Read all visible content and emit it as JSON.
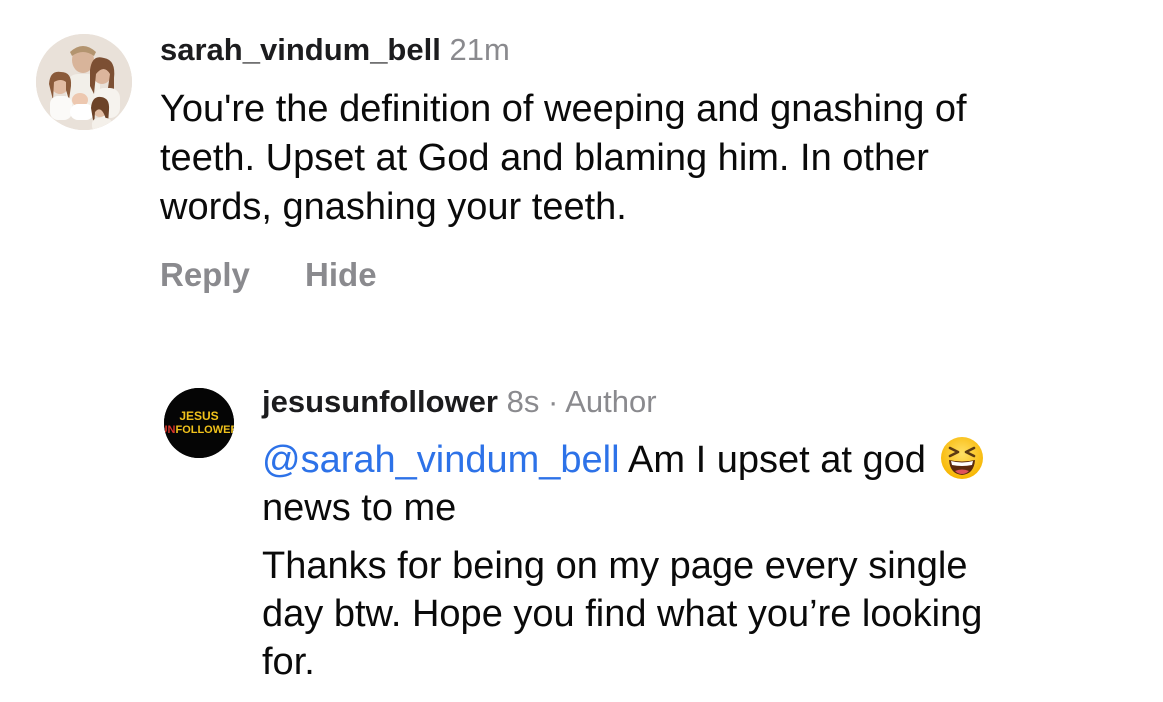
{
  "comment": {
    "username": "sarah_vindum_bell",
    "time": "21m",
    "text_lines": [
      "You're the definition of weeping and gnashing of",
      "teeth. Upset at God and blaming him. In other",
      "words, gnashing your teeth."
    ],
    "actions": {
      "reply": "Reply",
      "hide": "Hide"
    }
  },
  "reply": {
    "username": "jesusunfollower",
    "time": "8s",
    "separator": "·",
    "badge": "Author",
    "avatar_logo": {
      "line1": "JESUS",
      "line2_prefix": "UN",
      "line2_rest": "FOLLOWER"
    },
    "mention": "@sarah_vindum_bell",
    "text_after_mention": "Am I upset at god",
    "emoji": "grinning-squinting-face",
    "text_line2": "news to me",
    "paragraph2_lines": [
      "Thanks for being on my page every single",
      "day btw. Hope you find what you’re looking",
      "for."
    ]
  },
  "colors": {
    "username": "#1c1c1e",
    "meta": "#8a8a8e",
    "mention": "#2d72e8",
    "logo_red": "#d8342b",
    "logo_yellow": "#f1c21b"
  }
}
